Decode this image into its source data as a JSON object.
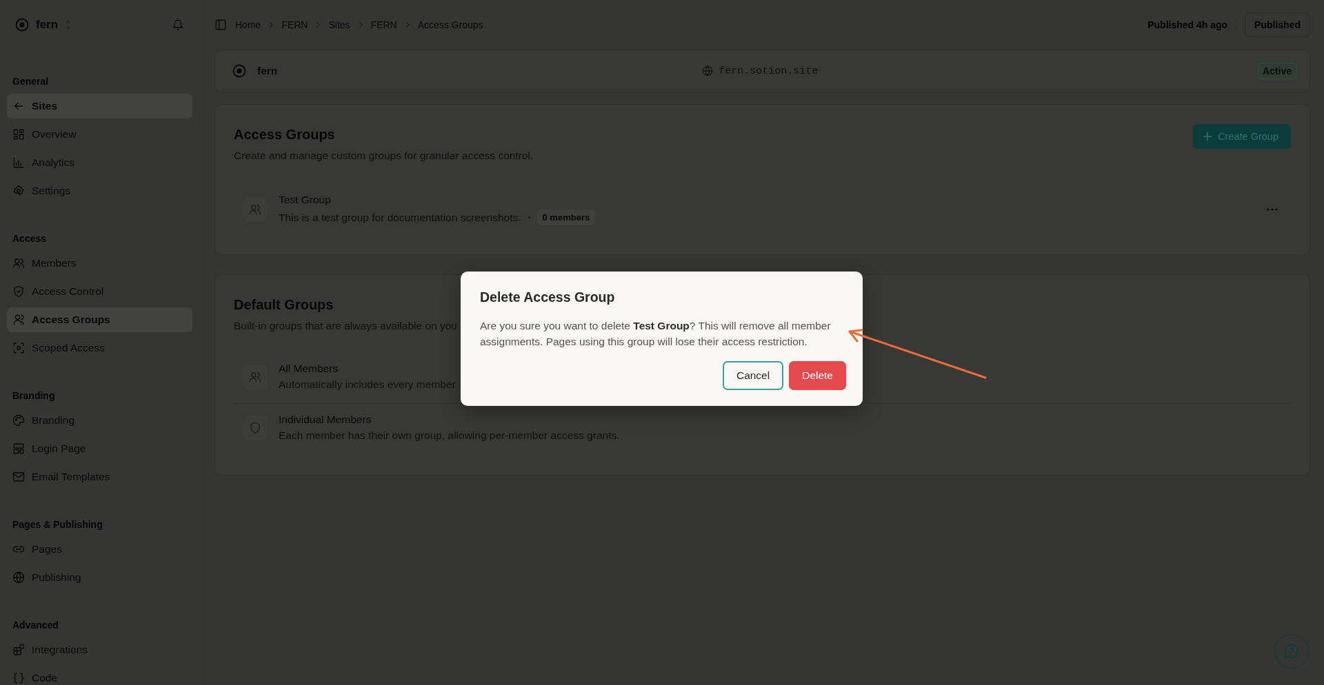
{
  "sidebar": {
    "brand": "fern",
    "sections": [
      {
        "title": "General",
        "items": [
          {
            "label": "Sites",
            "selected": true
          },
          {
            "label": "Overview",
            "selected": false
          },
          {
            "label": "Analytics",
            "selected": false
          },
          {
            "label": "Settings",
            "selected": false
          }
        ]
      },
      {
        "title": "Access",
        "items": [
          {
            "label": "Members",
            "selected": false
          },
          {
            "label": "Access Control",
            "selected": false
          },
          {
            "label": "Access Groups",
            "selected": true
          },
          {
            "label": "Scoped Access",
            "selected": false
          }
        ]
      },
      {
        "title": "Branding",
        "items": [
          {
            "label": "Branding",
            "selected": false
          },
          {
            "label": "Login Page",
            "selected": false
          },
          {
            "label": "Email Templates",
            "selected": false
          }
        ]
      },
      {
        "title": "Pages & Publishing",
        "items": [
          {
            "label": "Pages",
            "selected": false
          },
          {
            "label": "Publishing",
            "selected": false
          }
        ]
      },
      {
        "title": "Advanced",
        "items": [
          {
            "label": "Integrations",
            "selected": false
          },
          {
            "label": "Code",
            "selected": false
          }
        ]
      }
    ]
  },
  "breadcrumb": [
    "Home",
    "FERN",
    "Sites",
    "FERN",
    "Access Groups"
  ],
  "publish": {
    "status": "Published 4h ago",
    "button": "Published"
  },
  "site": {
    "name": "fern",
    "domain": "fern.sotion.site",
    "badge": "Active"
  },
  "access_groups": {
    "title": "Access Groups",
    "subtitle": "Create and manage custom groups for granular access control.",
    "create_button": "Create Group",
    "groups": [
      {
        "name": "Test Group",
        "description": "This is a test group for documentation screenshots.",
        "count": "0 members"
      }
    ]
  },
  "default_groups": {
    "title": "Default Groups",
    "subtitle": "Built-in groups that are always available on you",
    "groups": [
      {
        "name": "All Members",
        "description": "Automatically includes every member"
      },
      {
        "name": "Individual Members",
        "description": "Each member has their own group, allowing per-member access grants."
      }
    ]
  },
  "dialog": {
    "title": "Delete Access Group",
    "message": "Are you sure you want to delete **Test Group**? This will remove all member assignments. Pages using this group will lose their access restriction.",
    "cancel": "Cancel",
    "confirm": "Delete"
  }
}
